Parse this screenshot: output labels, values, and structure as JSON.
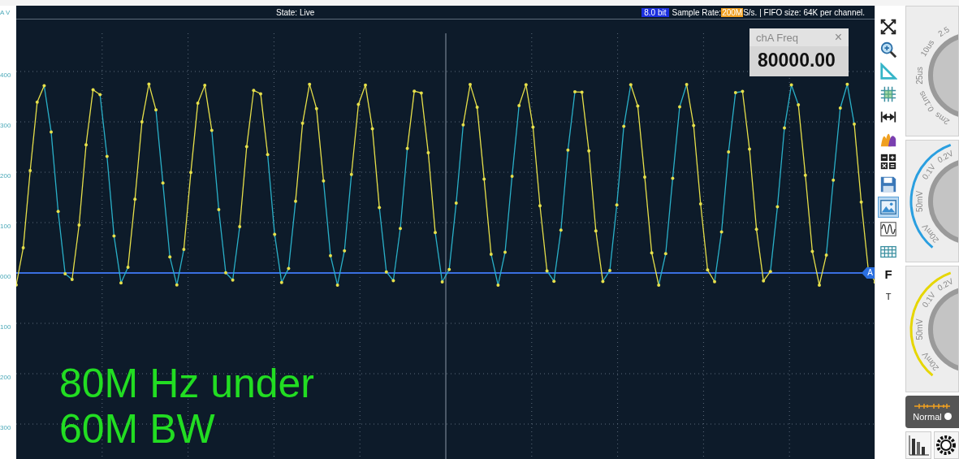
{
  "axis": {
    "unit": "A V",
    "ticks": [
      "400",
      "300",
      "200",
      "100",
      "000",
      "100",
      "200",
      "300"
    ]
  },
  "scope": {
    "state": "State: Live",
    "bit_depth": "8.0 bit",
    "sample_rate_label": "Sample Rate:",
    "sample_rate": "200M",
    "fifo": "S/s. | FIFO size: 64K per channel.",
    "marker": "A"
  },
  "measurement": {
    "title": "chA Freq",
    "close": "×",
    "value": "80000.00"
  },
  "annotation": [
    "80M Hz under",
    "60M BW"
  ],
  "toolbar": [
    {
      "kind": "fullscreen",
      "selected": false
    },
    {
      "kind": "zoom",
      "selected": false
    },
    {
      "kind": "ruler",
      "selected": false
    },
    {
      "kind": "grid",
      "selected": false
    },
    {
      "kind": "measure",
      "selected": false
    },
    {
      "kind": "histogram",
      "selected": false
    },
    {
      "kind": "calculator",
      "selected": false
    },
    {
      "kind": "save",
      "selected": false
    },
    {
      "kind": "image",
      "selected": true
    },
    {
      "kind": "wave",
      "selected": false
    },
    {
      "kind": "table",
      "selected": false
    },
    {
      "kind": "letter",
      "label": "F",
      "selected": false
    },
    {
      "kind": "letter",
      "label": "T",
      "selected": false
    }
  ],
  "knobs": [
    {
      "kind": "timebase",
      "labels": [
        "2.5",
        "10us",
        "25us",
        "0.1ms",
        "2ms"
      ]
    },
    {
      "kind": "channel",
      "color": "#2a9fe0",
      "labels": [
        "0.2V",
        "0.1V",
        "50mV",
        "20mV"
      ]
    },
    {
      "kind": "channel",
      "color": "#e6d600",
      "labels": [
        "0.2V",
        "0.1V",
        "50mV",
        "20mV"
      ]
    }
  ],
  "trigger": {
    "mode": "Normal"
  }
}
